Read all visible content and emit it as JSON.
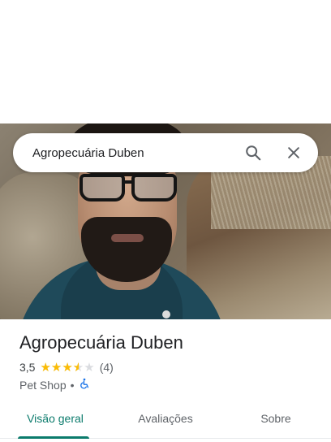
{
  "search": {
    "query": "Agropecuária Duben"
  },
  "place": {
    "name": "Agropecuária Duben",
    "rating": "3,5",
    "rating_fraction": 0.7,
    "stars_display": "★★★★★",
    "review_count": "(4)",
    "category": "Pet Shop",
    "separator": "•",
    "accessibility_icon": "wheelchair-icon"
  },
  "tabs": [
    {
      "label": "Visão geral",
      "active": true
    },
    {
      "label": "Avaliações",
      "active": false
    },
    {
      "label": "Sobre",
      "active": false
    }
  ],
  "colors": {
    "accent": "#0b7b6c",
    "star": "#fbbc04",
    "accessibility": "#1a73e8"
  }
}
